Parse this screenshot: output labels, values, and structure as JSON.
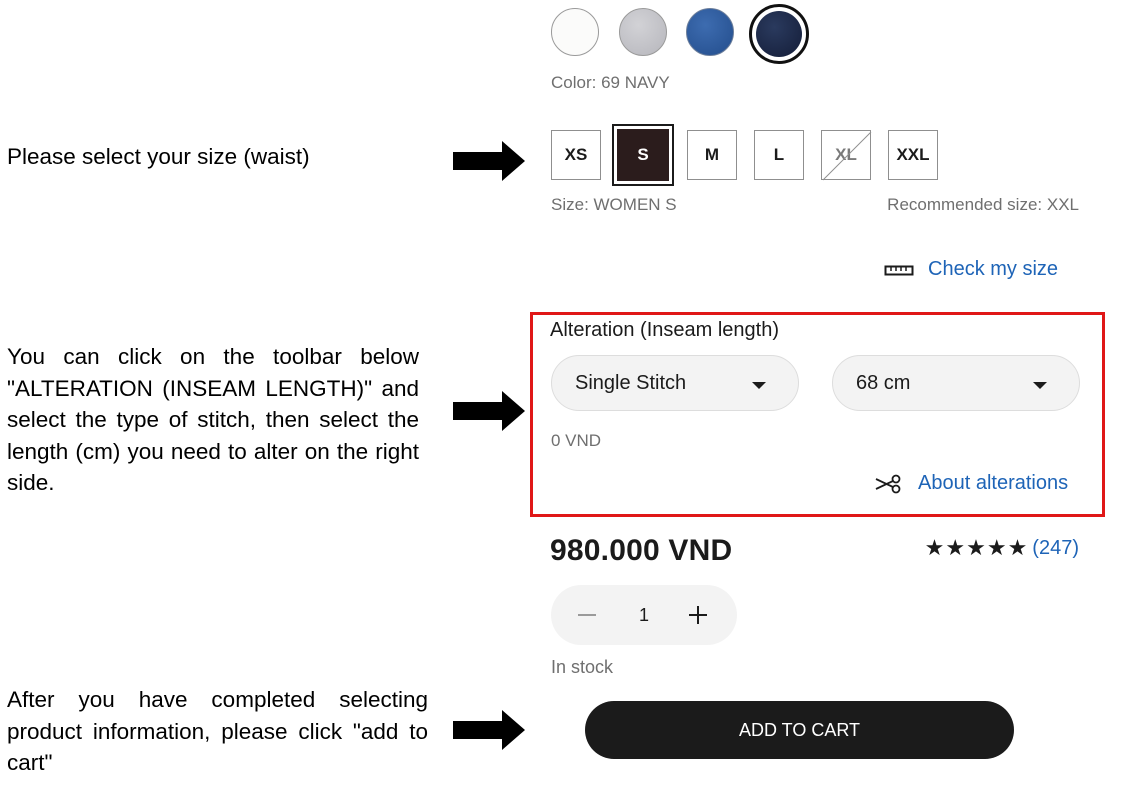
{
  "colors": {
    "selected_label": "Color: 69 NAVY",
    "swatches": [
      {
        "name": "white",
        "hex": "#fbfbfa"
      },
      {
        "name": "gray",
        "hex": "#c4c4c9"
      },
      {
        "name": "blue",
        "hex": "#2e5c9f"
      },
      {
        "name": "navy",
        "hex": "#1b2645",
        "selected": true
      }
    ]
  },
  "sizes": {
    "options": [
      {
        "label": "XS",
        "available": true
      },
      {
        "label": "S",
        "available": true,
        "selected": true
      },
      {
        "label": "M",
        "available": true
      },
      {
        "label": "L",
        "available": true
      },
      {
        "label": "XL",
        "available": false
      },
      {
        "label": "XXL",
        "available": true
      }
    ],
    "selected_label": "Size: WOMEN S",
    "recommended": "Recommended size: XXL",
    "check_link": "Check my size"
  },
  "alteration": {
    "title": "Alteration (Inseam length)",
    "stitch_value": "Single Stitch",
    "length_value": "68 cm",
    "fee": "0 VND",
    "about_link": "About alterations"
  },
  "product": {
    "price": "980.000 VND",
    "stars": "★★★★★",
    "rating_count": "(247)",
    "quantity": "1",
    "stock": "In stock",
    "add_to_cart": "ADD TO CART"
  },
  "instructions": {
    "size": "Please select your size (waist)",
    "alteration": "You can click on the toolbar below \"ALTERATION (INSEAM LENGTH)\" and select the type of stitch, then select the length (cm) you need to alter on the right side.",
    "cart": "After you have completed selecting product information, please click \"add to cart\""
  },
  "accent": {
    "red_highlight": "#e01717",
    "link_blue": "#1e64b7"
  }
}
